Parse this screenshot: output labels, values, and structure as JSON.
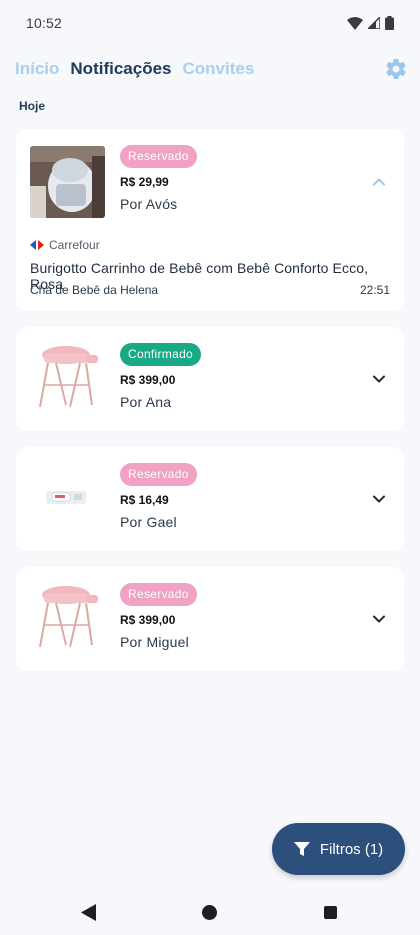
{
  "status_bar": {
    "time": "10:52"
  },
  "nav": {
    "tabs": [
      {
        "label": "Início",
        "active": false
      },
      {
        "label": "Notificações",
        "active": true
      },
      {
        "label": "Convites",
        "active": false
      }
    ],
    "settings_icon": "gear-icon"
  },
  "section": {
    "title": "Hoje"
  },
  "notifications": [
    {
      "status": "Reservado",
      "price": "R$ 29,99",
      "by": "Por Avós",
      "expanded": true,
      "store": "Carrefour",
      "product": "Burigotto Carrinho de Bebê com Bebê Conforto Ecco, Rosa",
      "event": "Chá de Bebê da Helena",
      "time": "22:51"
    },
    {
      "status": "Confirmado",
      "price": "R$ 399,00",
      "by": "Por Ana",
      "expanded": false
    },
    {
      "status": "Reservado",
      "price": "R$ 16,49",
      "by": "Por Gael",
      "expanded": false
    },
    {
      "status": "Reservado",
      "price": "R$ 399,00",
      "by": "Por Miguel",
      "expanded": false
    }
  ],
  "fab": {
    "label": "Filtros (1)",
    "icon": "filter-icon"
  },
  "colors": {
    "reserved": "#efa2c3",
    "confirmed": "#1aa986",
    "primary": "#2c4f7c",
    "tab_inactive": "#a9cff0"
  }
}
